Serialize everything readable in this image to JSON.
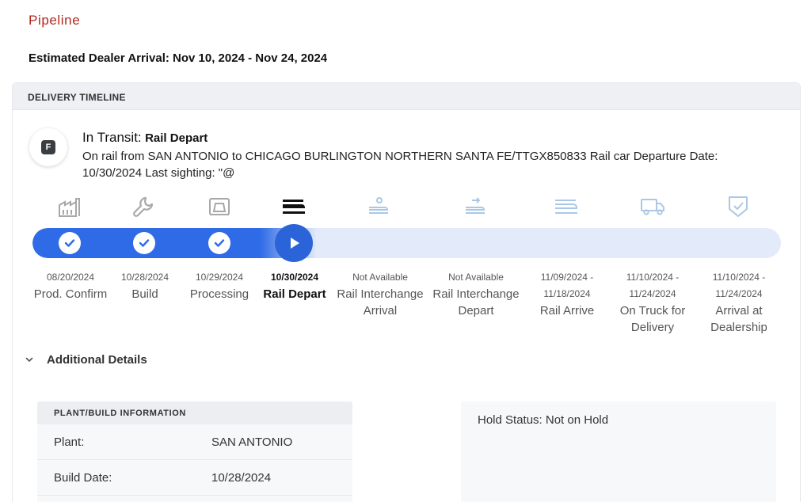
{
  "page": {
    "title": "Pipeline",
    "arrival_label": "Estimated Dealer Arrival:",
    "arrival_range": "Nov 10, 2024 - Nov 24, 2024"
  },
  "timeline": {
    "header": "DELIVERY TIMELINE",
    "badge_letter": "F",
    "status_label": "In Transit:",
    "status_value": "Rail Depart",
    "description": "On rail from SAN ANTONIO to CHICAGO BURLINGTON NORTHERN SANTA FE/TTGX850833 Rail car Departure Date: 10/30/2024 Last sighting: \"@",
    "progress_fraction": 0.38,
    "current_stage_index": 3,
    "stages": [
      {
        "date": "08/20/2024",
        "name": "Prod. Confirm",
        "icon": "factory-icon",
        "state": "complete"
      },
      {
        "date": "10/28/2024",
        "name": "Build",
        "icon": "wrench-icon",
        "state": "complete"
      },
      {
        "date": "10/29/2024",
        "name": "Processing",
        "icon": "processing-icon",
        "state": "complete"
      },
      {
        "date": "10/30/2024",
        "name": "Rail Depart",
        "icon": "train-icon",
        "state": "current"
      },
      {
        "date": "Not Available",
        "name": "Rail Interchange Arrival",
        "icon": "rail-interchange-arrival-icon",
        "state": "pending"
      },
      {
        "date": "Not Available",
        "name": "Rail Interchange Depart",
        "icon": "rail-interchange-depart-icon",
        "state": "pending"
      },
      {
        "date": "11/09/2024 - 11/18/2024",
        "name": "Rail Arrive",
        "icon": "train-arrive-icon",
        "state": "pending"
      },
      {
        "date": "11/10/2024 - 11/24/2024",
        "name": "On Truck for Delivery",
        "icon": "truck-icon",
        "state": "pending"
      },
      {
        "date": "11/10/2024 - 11/24/2024",
        "name": "Arrival at Dealership",
        "icon": "shield-check-icon",
        "state": "pending"
      }
    ]
  },
  "additional": {
    "label": "Additional Details",
    "plant_header": "PLANT/BUILD INFORMATION",
    "rows": [
      {
        "key": "Plant:",
        "value": "SAN ANTONIO"
      },
      {
        "key": "Build Date:",
        "value": "10/28/2024"
      }
    ],
    "hold_status": "Hold Status: Not on Hold"
  },
  "colors": {
    "brand_red": "#b3261e",
    "progress_blue": "#2f6be6",
    "track_light": "#e3ebfb",
    "pending_icon": "#aac8e6",
    "complete_icon": "#a8a8a8"
  }
}
